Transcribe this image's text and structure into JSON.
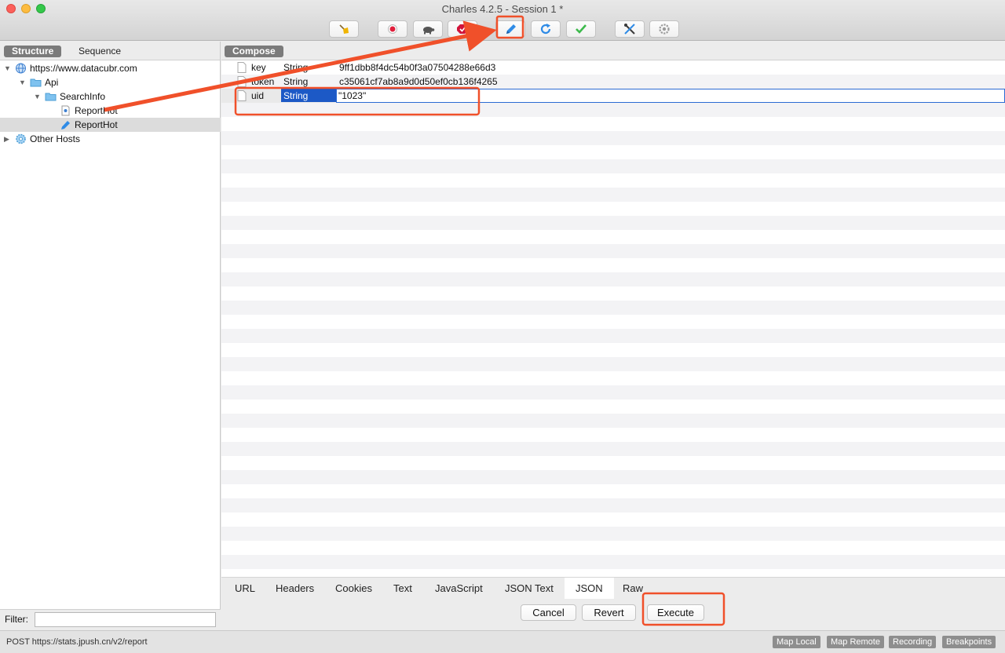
{
  "window": {
    "title": "Charles 4.2.5 - Session 1 *"
  },
  "toolbar": {
    "buttons": [
      {
        "name": "broom-icon",
        "color": "#f0b400"
      },
      {
        "name": "record-icon",
        "color": "#e01f3c"
      },
      {
        "name": "turtle-icon",
        "color": "#555555"
      },
      {
        "name": "breakpoint-icon",
        "color": "#d2133a"
      },
      {
        "name": "compose-pen-icon",
        "color": "#2f8be6"
      },
      {
        "name": "repeat-icon",
        "color": "#2f8be6"
      },
      {
        "name": "validate-check-icon",
        "color": "#3cba4b"
      },
      {
        "name": "tools-icon",
        "color": "#3a3a3a"
      },
      {
        "name": "settings-gear-icon",
        "color": "#9a9a9a"
      }
    ]
  },
  "left": {
    "tabs": {
      "structure": "Structure",
      "sequence": "Sequence"
    },
    "tree": [
      {
        "label": "https://www.datacubr.com",
        "icon": "globe-icon"
      },
      {
        "label": "Api",
        "icon": "folder-icon"
      },
      {
        "label": "SearchInfo",
        "icon": "folder-icon"
      },
      {
        "label": "ReportHot",
        "icon": "request-doc-icon"
      },
      {
        "label": "ReportHot",
        "icon": "compose-pen-icon"
      },
      {
        "label": "Other Hosts",
        "icon": "gear-globe-icon"
      }
    ],
    "filter": {
      "label": "Filter:",
      "value": ""
    }
  },
  "right": {
    "tab": "Compose",
    "params": [
      {
        "key": "key",
        "type": "String",
        "value": "9ff1dbb8f4dc54b0f3a07504288e66d3"
      },
      {
        "key": "token",
        "type": "String",
        "value": "c35061cf7ab8a9d0d50ef0cb136f4265"
      },
      {
        "key": "uid",
        "type": "String",
        "value": "\"1023\""
      }
    ],
    "bottom_tabs": [
      "URL",
      "Headers",
      "Cookies",
      "Text",
      "JavaScript",
      "JSON Text",
      "JSON",
      "Raw"
    ],
    "active_bottom_tab": "JSON",
    "buttons": {
      "cancel": "Cancel",
      "revert": "Revert",
      "execute": "Execute"
    }
  },
  "status": {
    "text": "POST https://stats.jpush.cn/v2/report",
    "buttons": [
      "Map Local",
      "Map Remote",
      "Recording",
      "Breakpoints"
    ]
  },
  "annotation_color": "#f0502a"
}
